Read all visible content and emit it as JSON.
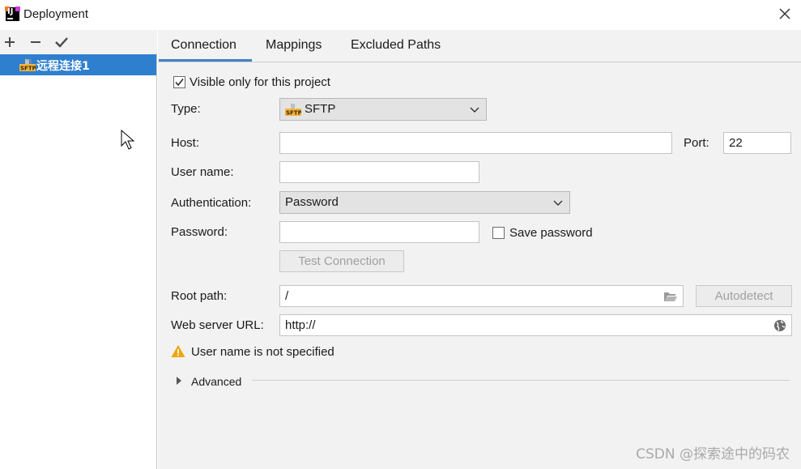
{
  "window": {
    "title": "Deployment"
  },
  "left": {
    "toolbar": {
      "add": "+",
      "remove": "−",
      "apply": "✔"
    },
    "servers": [
      {
        "label": "远程连接1",
        "icon": "sftp-icon"
      }
    ]
  },
  "tabs": [
    "Connection",
    "Mappings",
    "Excluded Paths"
  ],
  "form": {
    "visible_only_label": "Visible only for this project",
    "visible_only_checked": true,
    "type_label": "Type:",
    "type_value": "SFTP",
    "host_label": "Host:",
    "host_value": "",
    "port_label": "Port:",
    "port_value": "22",
    "username_label": "User name:",
    "username_value": "",
    "auth_label": "Authentication:",
    "auth_value": "Password",
    "password_label": "Password:",
    "password_value": "",
    "save_password_label": "Save password",
    "save_password_checked": false,
    "test_connection_label": "Test Connection",
    "root_path_label": "Root path:",
    "root_path_value": "/",
    "autodetect_label": "Autodetect",
    "web_url_label": "Web server URL:",
    "web_url_value": "http://",
    "warning_text": "User name is not specified",
    "advanced_label": "Advanced"
  },
  "watermark": "CSDN @探索途中的码农",
  "colors": {
    "selection": "#2f7fcf",
    "tab_underline": "#4083c9",
    "warning": "#f0a30a"
  }
}
